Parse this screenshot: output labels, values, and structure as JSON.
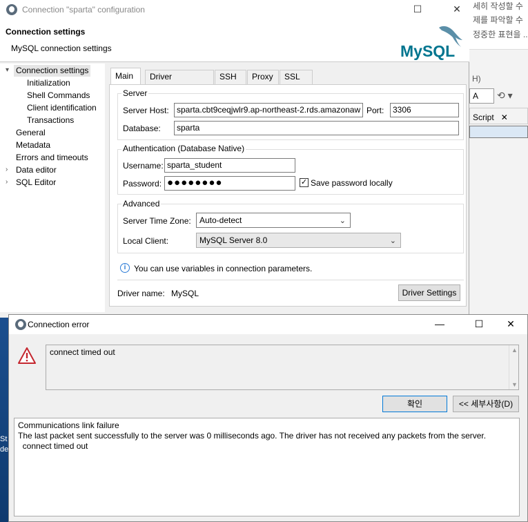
{
  "background": {
    "korean_lines": [
      "세히 작성할 수",
      "제를 파악할 수",
      "정중한 표현을 ..."
    ],
    "hint": "H)",
    "combo_value": "A",
    "script_tab": "Script",
    "left_text_1": "St",
    "left_text_2": "de"
  },
  "config_dialog": {
    "title": "Connection \"sparta\" configuration",
    "header_title": "Connection settings",
    "header_subtitle": "MySQL connection settings",
    "logo_text": "MySQL",
    "nav": [
      {
        "label": "Connection settings",
        "level": 0,
        "expanded": true,
        "selected": true
      },
      {
        "label": "Initialization",
        "level": 1
      },
      {
        "label": "Shell Commands",
        "level": 1
      },
      {
        "label": "Client identification",
        "level": 1
      },
      {
        "label": "Transactions",
        "level": 1
      },
      {
        "label": "General",
        "level": 0
      },
      {
        "label": "Metadata",
        "level": 0
      },
      {
        "label": "Errors and timeouts",
        "level": 0
      },
      {
        "label": "Data editor",
        "level": 0,
        "collapsed": true
      },
      {
        "label": "SQL Editor",
        "level": 0,
        "collapsed": true
      }
    ],
    "tabs": [
      "Main",
      "Driver properties",
      "SSH",
      "Proxy",
      "SSL"
    ],
    "server": {
      "group_label": "Server",
      "host_label": "Server Host:",
      "host_value": "sparta.cbt9ceqjwlr9.ap-northeast-2.rds.amazonaw",
      "port_label": "Port:",
      "port_value": "3306",
      "db_label": "Database:",
      "db_value": "sparta"
    },
    "auth": {
      "group_label": "Authentication (Database Native)",
      "username_label": "Username:",
      "username_value": "sparta_student",
      "password_label": "Password:",
      "password_mask": "●●●●●●●●",
      "save_password_label": "Save password locally",
      "save_password_checked": true
    },
    "advanced": {
      "group_label": "Advanced",
      "timezone_label": "Server Time Zone:",
      "timezone_value": "Auto-detect",
      "client_label": "Local Client:",
      "client_value": "MySQL Server 8.0"
    },
    "info_text": "You can use variables in connection parameters.",
    "driver_label": "Driver name:",
    "driver_value": "MySQL",
    "driver_settings_button": "Driver Settings"
  },
  "error_dialog": {
    "title": "Connection error",
    "message": "connect timed out",
    "ok_button": "확인",
    "details_button": "<< 세부사항(D)",
    "details": [
      "Communications link failure",
      "The last packet sent successfully to the server was 0 milliseconds ago. The driver has not received any packets from the server.",
      "  connect timed out"
    ]
  }
}
